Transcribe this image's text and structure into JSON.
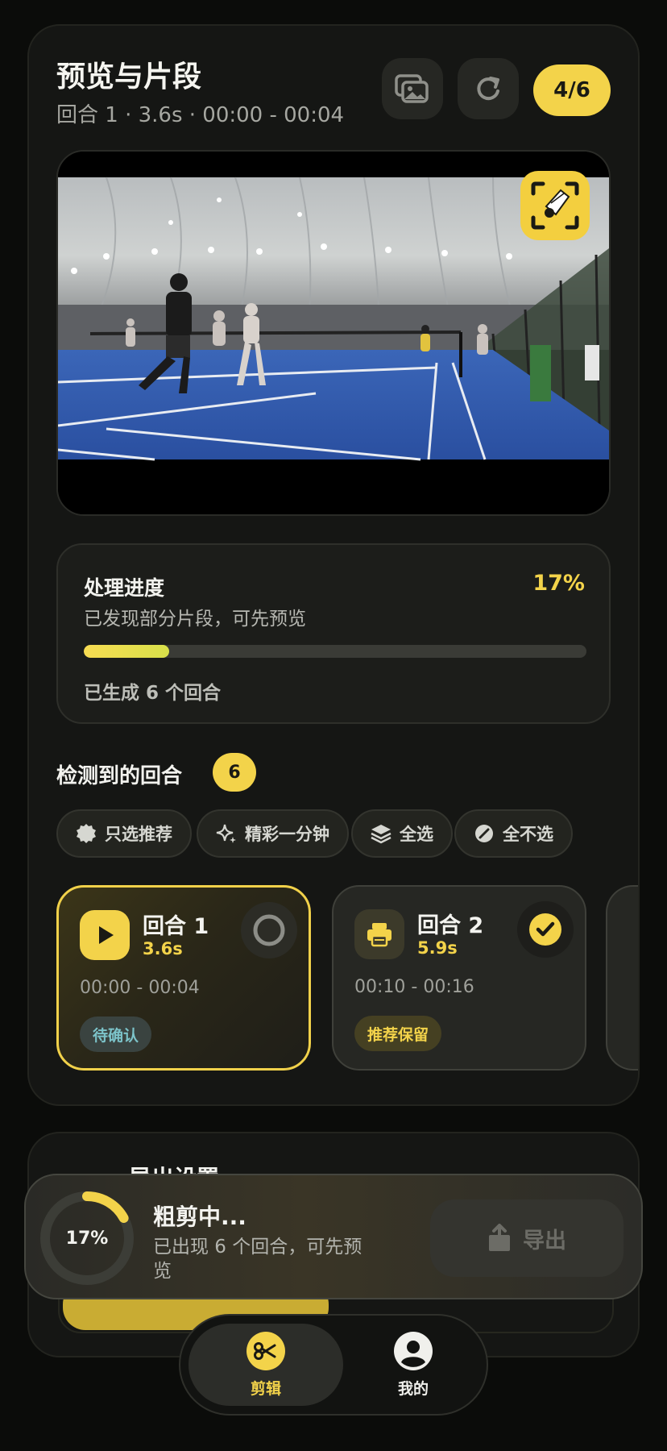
{
  "header": {
    "title": "预览与片段",
    "subtitle": "回合 1 · 3.6s · 00:00 - 00:04",
    "gallery_icon": "gallery-icon",
    "refresh_icon": "refresh-icon",
    "counter": "4/6"
  },
  "video": {
    "scene": "indoor-badminton-hall",
    "scan_icon": "shuttlecock-scan-icon"
  },
  "progress": {
    "title": "处理进度",
    "percent_label": "17%",
    "percent_value": 0.17,
    "status": "已发现部分片段，可先预览",
    "generated": "已生成 6 个回合"
  },
  "rallies_section": {
    "title": "检测到的回合",
    "count": "6",
    "filters": [
      {
        "label": "只选推荐",
        "icon": "badge-icon"
      },
      {
        "label": "精彩一分钟",
        "icon": "sparkle-icon"
      },
      {
        "label": "全选",
        "icon": "layers-icon"
      },
      {
        "label": "全不选",
        "icon": "slash-circle-icon"
      }
    ],
    "cards": [
      {
        "name": "回合 1",
        "duration": "3.6s",
        "range": "00:00 - 00:04",
        "tag": "待确认",
        "icon": "play-icon",
        "selected": false
      },
      {
        "name": "回合 2",
        "duration": "5.9s",
        "range": "00:10 - 00:16",
        "tag": "推荐保留",
        "icon": "printer-icon",
        "selected": true
      }
    ]
  },
  "export_settings": {
    "title": "导出设置"
  },
  "toast": {
    "percent_label": "17%",
    "percent_value": 0.17,
    "title": "粗剪中...",
    "subtitle": "已出现 6 个回合，可先预览",
    "export_label": "导出",
    "export_icon": "share-icon"
  },
  "tabbar": {
    "items": [
      {
        "label": "剪辑",
        "icon": "scissors-icon",
        "active": true
      },
      {
        "label": "我的",
        "icon": "user-icon",
        "active": false
      }
    ]
  },
  "colors": {
    "accent": "#f3d34a",
    "background": "#0b0c0a",
    "card": "#151614"
  }
}
